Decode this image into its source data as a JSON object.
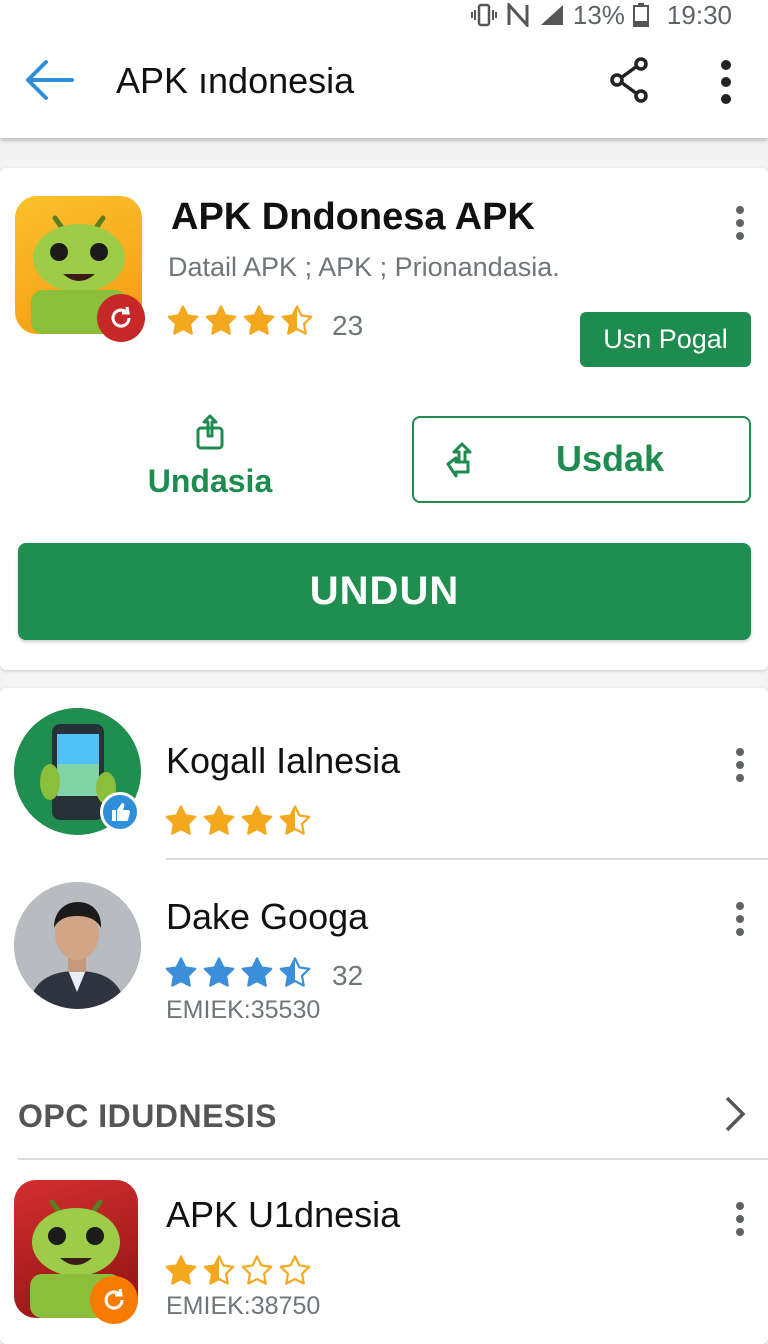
{
  "status_bar": {
    "battery_text": "13%",
    "time": "19:30"
  },
  "app_bar": {
    "title": "APK ındonesia"
  },
  "featured": {
    "name": "APK Dndonesa APK",
    "subtitle": "Datail APK ; APK ; Prionandasia.",
    "rating_stars": 3.5,
    "rating_count": "23",
    "tag_button": "Usn Pogal",
    "share_action_label": "Undasia",
    "secondary_button": "Usdak",
    "primary_button": "UNDUN"
  },
  "list": [
    {
      "name": "Kogall Ialnesia",
      "rating_stars": 3.5,
      "rating_count": "",
      "meta": ""
    },
    {
      "name": "Dake Googa",
      "rating_stars": 3.5,
      "rating_count": "32",
      "meta": "EMIEK:35530"
    }
  ],
  "section": {
    "title": "OPC IDUDNESIS",
    "items": [
      {
        "name": "APK U1dnesia",
        "rating_stars": 1.5,
        "meta": "EMIEK:38750"
      }
    ]
  },
  "colors": {
    "accent_green": "#1e8c4e",
    "back_arrow_blue": "#2f8fd8",
    "star_gold": "#f4a81d",
    "star_blue": "#3a8fd8"
  },
  "icons": [
    "back-arrow-icon",
    "share-icon",
    "more-vert-icon",
    "refresh-icon",
    "thumbs-up-icon",
    "chevron-right-icon",
    "star-icon"
  ]
}
